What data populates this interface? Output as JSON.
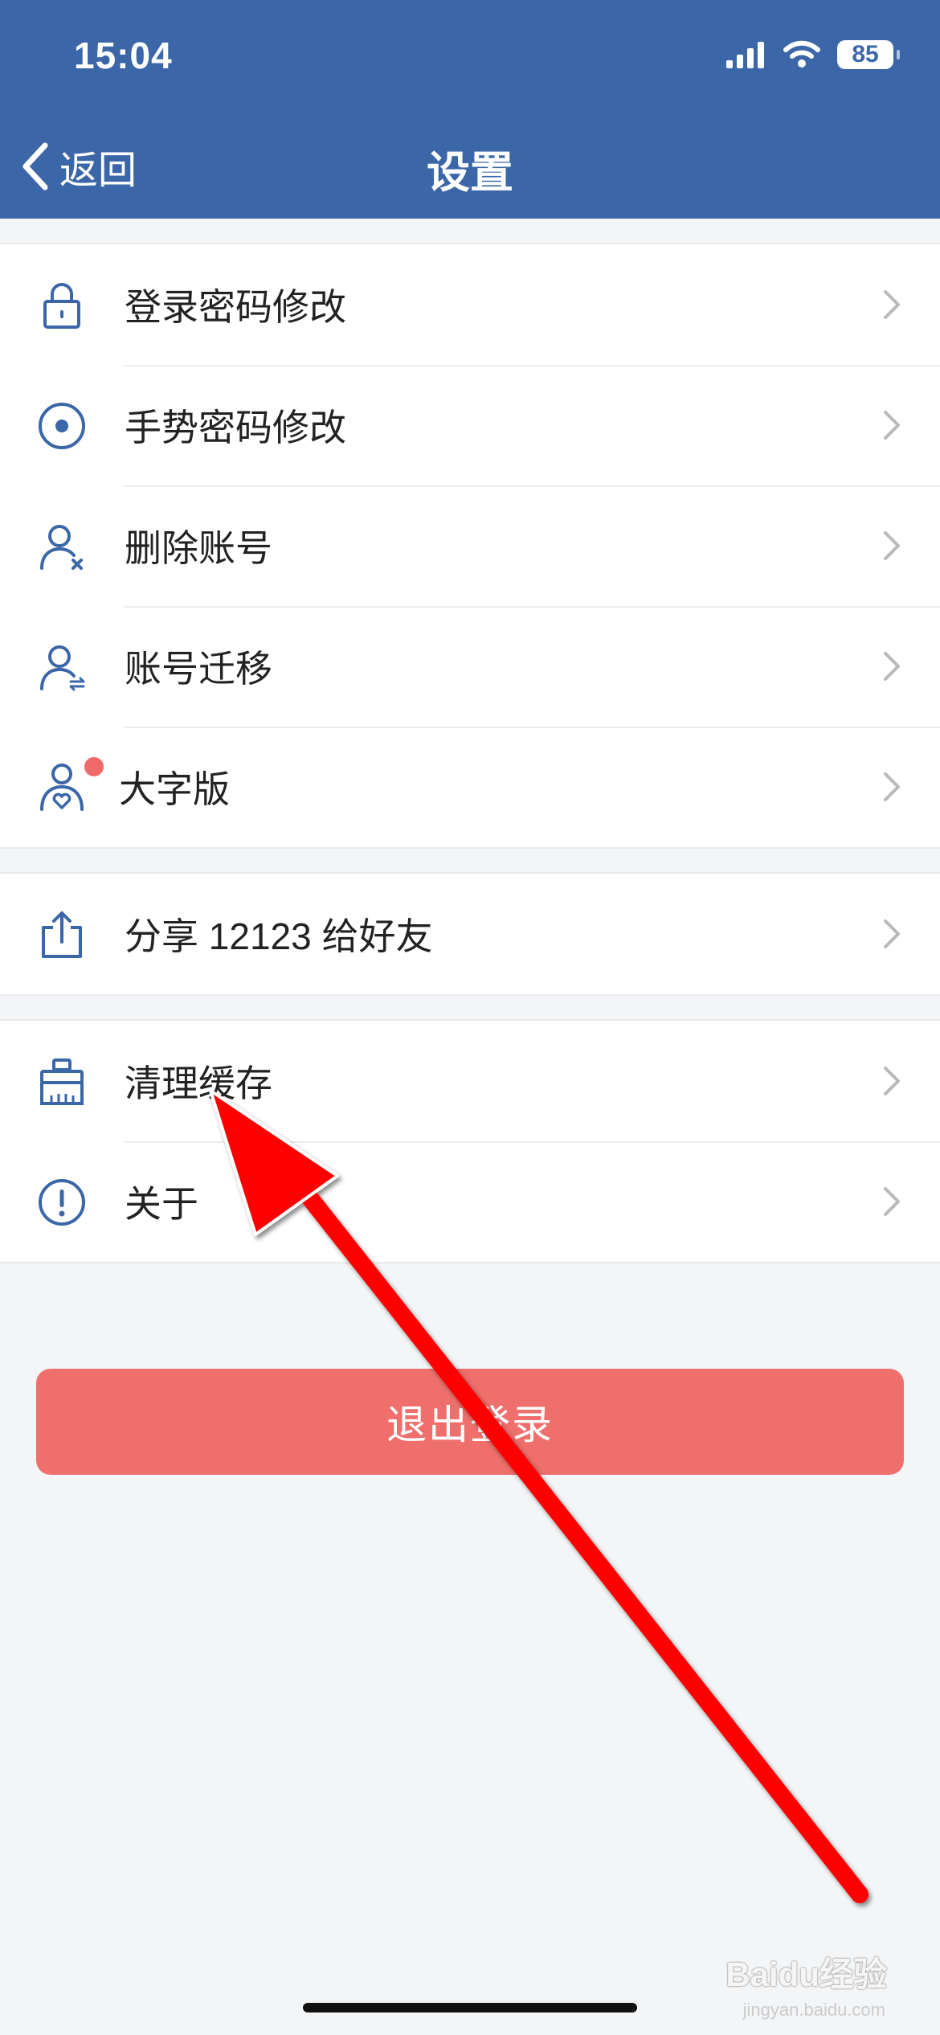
{
  "status_bar": {
    "time": "15:04",
    "battery": "85"
  },
  "nav": {
    "back_label": "返回",
    "title": "设置"
  },
  "groups": [
    {
      "items": [
        {
          "label": "登录密码修改",
          "icon": "lock-icon"
        },
        {
          "label": "手势密码修改",
          "icon": "gesture-target-icon"
        },
        {
          "label": "删除账号",
          "icon": "user-delete-icon"
        },
        {
          "label": "账号迁移",
          "icon": "user-transfer-icon"
        },
        {
          "label": "大字版",
          "icon": "elder-care-icon",
          "badge": true
        }
      ]
    },
    {
      "items": [
        {
          "label": "分享 12123 给好友",
          "icon": "share-icon"
        }
      ]
    },
    {
      "items": [
        {
          "label": "清理缓存",
          "icon": "broom-icon"
        },
        {
          "label": "关于",
          "icon": "info-icon"
        }
      ]
    }
  ],
  "logout_label": "退出登录",
  "colors": {
    "nav_bg": "#3b67a8",
    "logout_bg": "#ee6f6c",
    "icon": "#3b67a8",
    "arrow": "#ff0000"
  },
  "watermark": {
    "brand": "Baidu经验",
    "url": "jingyan.baidu.com"
  }
}
